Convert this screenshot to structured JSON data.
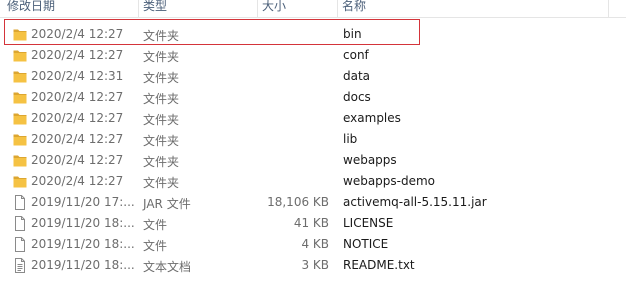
{
  "columns": {
    "modified": "修改日期",
    "type": "类型",
    "size": "大小",
    "name": "名称"
  },
  "rows": [
    {
      "date": "2020/2/4 12:27",
      "type": "文件夹",
      "size": "",
      "name": "bin",
      "icon": "folder-icon"
    },
    {
      "date": "2020/2/4 12:27",
      "type": "文件夹",
      "size": "",
      "name": "conf",
      "icon": "folder-icon"
    },
    {
      "date": "2020/2/4 12:31",
      "type": "文件夹",
      "size": "",
      "name": "data",
      "icon": "folder-icon"
    },
    {
      "date": "2020/2/4 12:27",
      "type": "文件夹",
      "size": "",
      "name": "docs",
      "icon": "folder-icon"
    },
    {
      "date": "2020/2/4 12:27",
      "type": "文件夹",
      "size": "",
      "name": "examples",
      "icon": "folder-icon"
    },
    {
      "date": "2020/2/4 12:27",
      "type": "文件夹",
      "size": "",
      "name": "lib",
      "icon": "folder-icon"
    },
    {
      "date": "2020/2/4 12:27",
      "type": "文件夹",
      "size": "",
      "name": "webapps",
      "icon": "folder-icon"
    },
    {
      "date": "2020/2/4 12:27",
      "type": "文件夹",
      "size": "",
      "name": "webapps-demo",
      "icon": "folder-icon"
    },
    {
      "date": "2019/11/20 17:...",
      "type": "JAR 文件",
      "size": "18,106 KB",
      "name": "activemq-all-5.15.11.jar",
      "icon": "file-icon"
    },
    {
      "date": "2019/11/20 18:...",
      "type": "文件",
      "size": "41 KB",
      "name": "LICENSE",
      "icon": "file-icon"
    },
    {
      "date": "2019/11/20 18:...",
      "type": "文件",
      "size": "4 KB",
      "name": "NOTICE",
      "icon": "file-icon"
    },
    {
      "date": "2019/11/20 18:...",
      "type": "文本文档",
      "size": "3 KB",
      "name": "README.txt",
      "icon": "text-file-icon"
    }
  ],
  "colors": {
    "folder": "#f5c243",
    "folder_dark": "#dca631",
    "highlight_border": "#d4343a",
    "header_text": "#4c607a"
  }
}
